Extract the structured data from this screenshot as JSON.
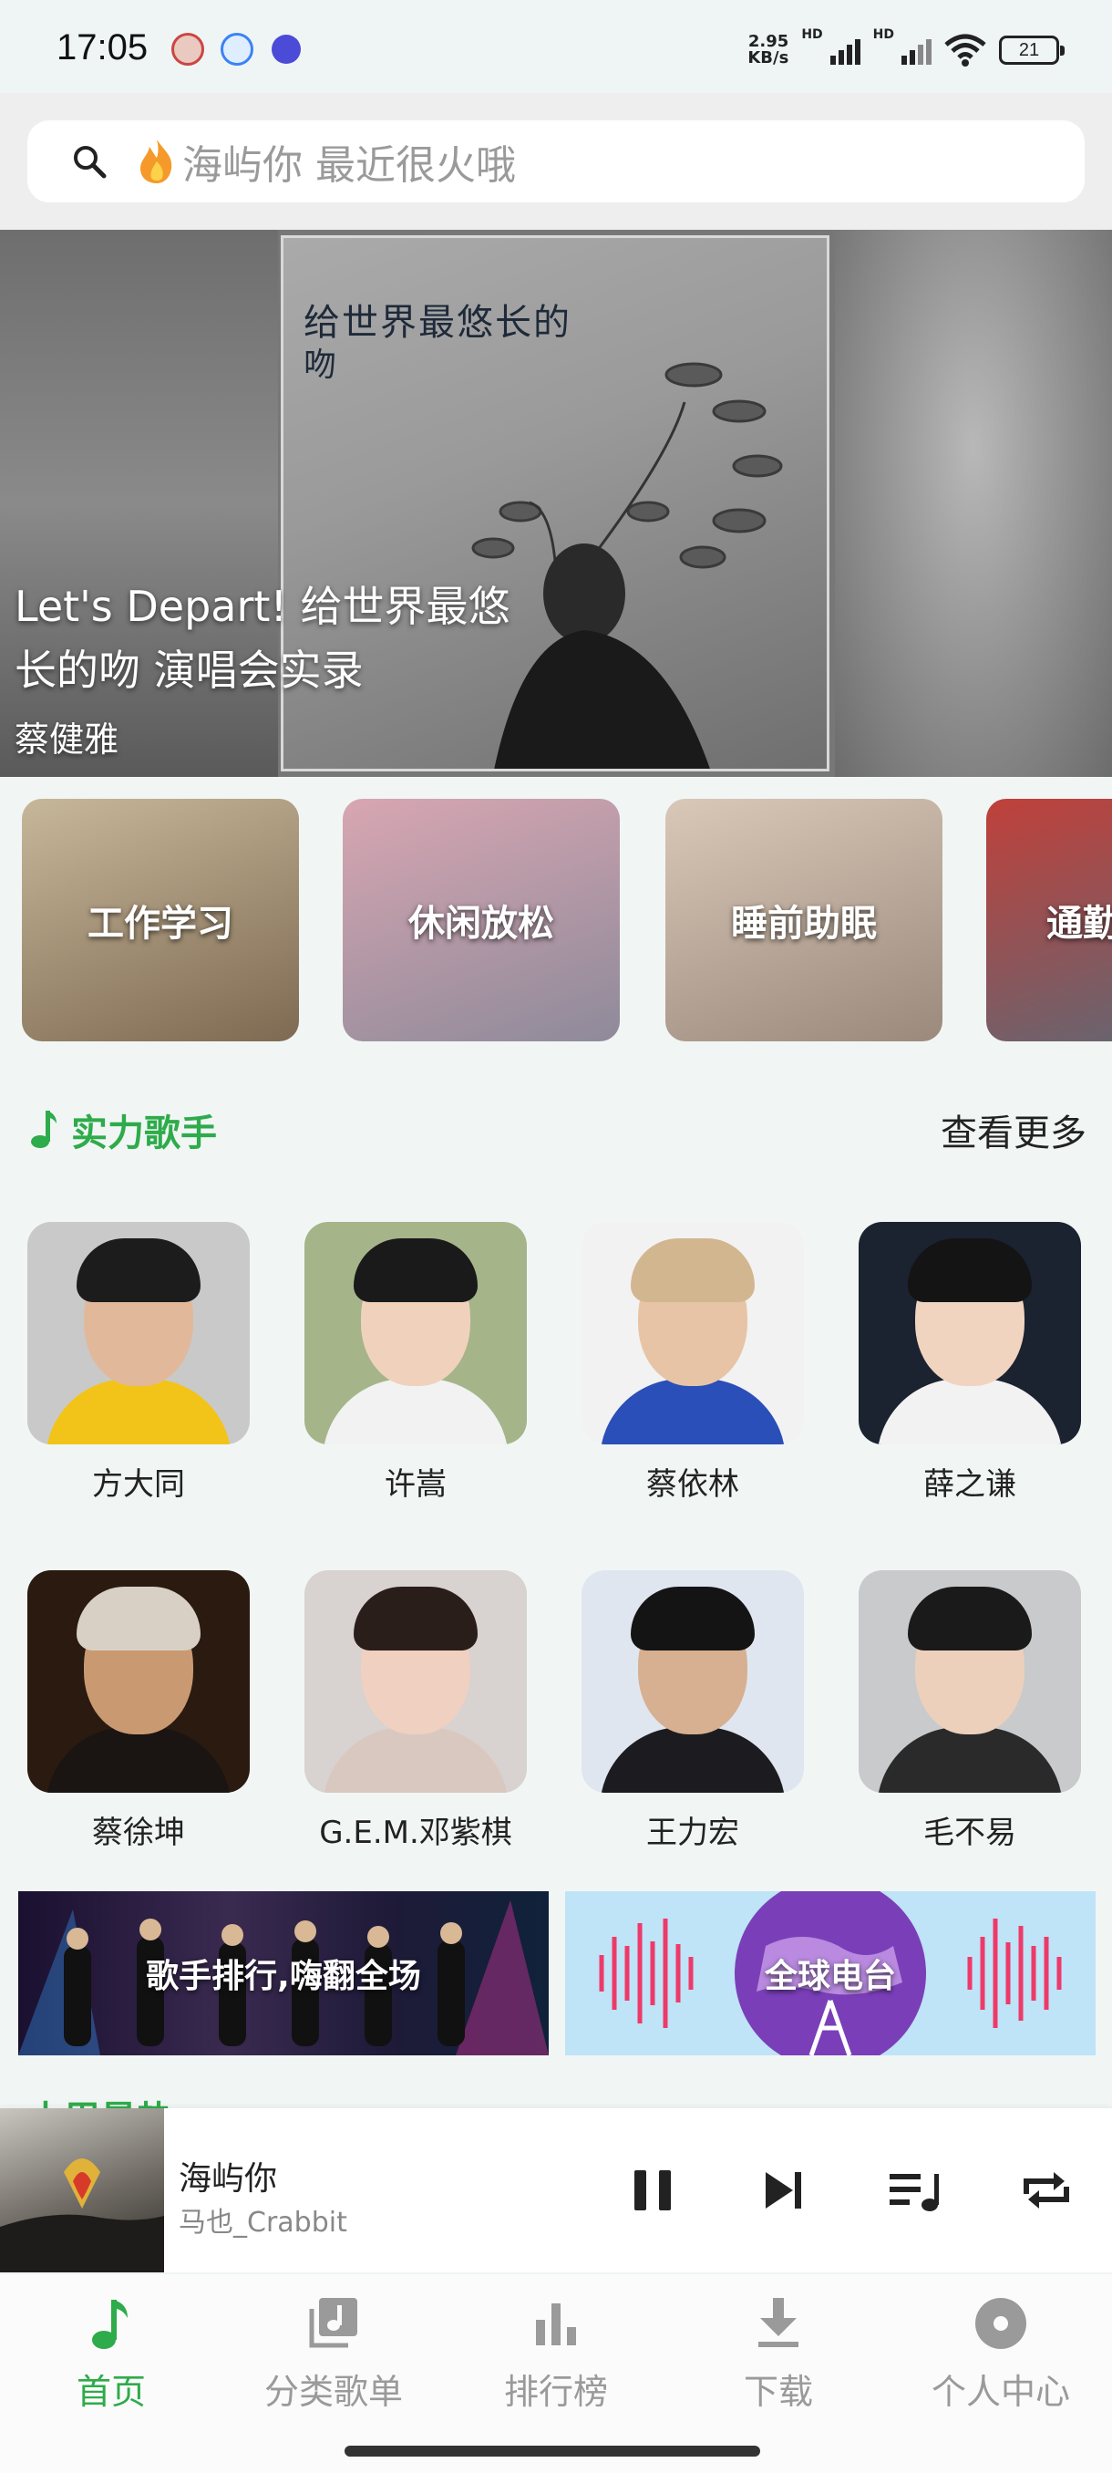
{
  "status_bar": {
    "time": "17:05",
    "net_speed_value": "2.95",
    "net_speed_unit": "KB/s",
    "hd1": "HD",
    "hd2": "HD",
    "battery": "21"
  },
  "search": {
    "placeholder": "海屿你 最近很火哦",
    "prefix_icon": "fire-icon"
  },
  "banner": {
    "art_title": "给世界最悠长的",
    "art_sub": "吻",
    "caption_line1": "Let's Depart! 给世界最悠",
    "caption_line2": "长的吻 演唱会实录",
    "artist": "蔡健雅"
  },
  "moods": [
    {
      "label": "工作学习",
      "colors": [
        "#c7b79a",
        "#7e6a52"
      ]
    },
    {
      "label": "休闲放松",
      "colors": [
        "#d8a6b2",
        "#8e8a9a"
      ]
    },
    {
      "label": "睡前助眠",
      "colors": [
        "#d9c8b8",
        "#9b8a7c"
      ]
    },
    {
      "label": "通勤",
      "colors": [
        "#c0403a",
        "#5a6a78"
      ]
    }
  ],
  "section": {
    "title": "实力歌手",
    "more": "查看更多"
  },
  "singers": [
    {
      "name": "方大同",
      "bg": "#c9c9c9",
      "skin": "#e2b89a",
      "hair": "#1c1c1c",
      "cloth": "#f2c41a"
    },
    {
      "name": "许嵩",
      "bg": "#a6b48a",
      "skin": "#f0d2bc",
      "hair": "#1a1a1a",
      "cloth": "#f2f2f2"
    },
    {
      "name": "蔡依林",
      "bg": "#f2f2f2",
      "skin": "#e8c4a6",
      "hair": "#d2b690",
      "cloth": "#2a4fb8"
    },
    {
      "name": "薛之谦",
      "bg": "#1b2230",
      "skin": "#f0d4c0",
      "hair": "#141414",
      "cloth": "#f2f2f2"
    },
    {
      "name": "蔡徐坤",
      "bg": "#2a1a10",
      "skin": "#c99a72",
      "hair": "#d8d0c4",
      "cloth": "#1a1412"
    },
    {
      "name": "G.E.M.邓紫棋",
      "bg": "#d8d2d0",
      "skin": "#f0d0c0",
      "hair": "#2a1e1a",
      "cloth": "#d8c8c0"
    },
    {
      "name": "王力宏",
      "bg": "#dfe6f0",
      "skin": "#d6b090",
      "hair": "#141414",
      "cloth": "#1c1c20"
    },
    {
      "name": "毛不易",
      "bg": "#c8cacc",
      "skin": "#ecd0bc",
      "hair": "#1a1a1a",
      "cloth": "#2a2a2a"
    }
  ],
  "promos": [
    {
      "label": "歌手排行,嗨翻全场"
    },
    {
      "label": "全球电台"
    }
  ],
  "weekly_title": "本周最热",
  "player": {
    "title": "海屿你",
    "artist": "马也_Crabbit"
  },
  "nav": [
    {
      "label": "首页",
      "icon": "music-note-icon",
      "active": true
    },
    {
      "label": "分类歌单",
      "icon": "playlist-icon",
      "active": false
    },
    {
      "label": "排行榜",
      "icon": "bar-chart-icon",
      "active": false
    },
    {
      "label": "下载",
      "icon": "download-icon",
      "active": false
    },
    {
      "label": "个人中心",
      "icon": "disc-icon",
      "active": false
    }
  ],
  "colors": {
    "accent": "#2eab4a",
    "background": "#f1f6f5",
    "inactive": "#9a9a9a"
  }
}
